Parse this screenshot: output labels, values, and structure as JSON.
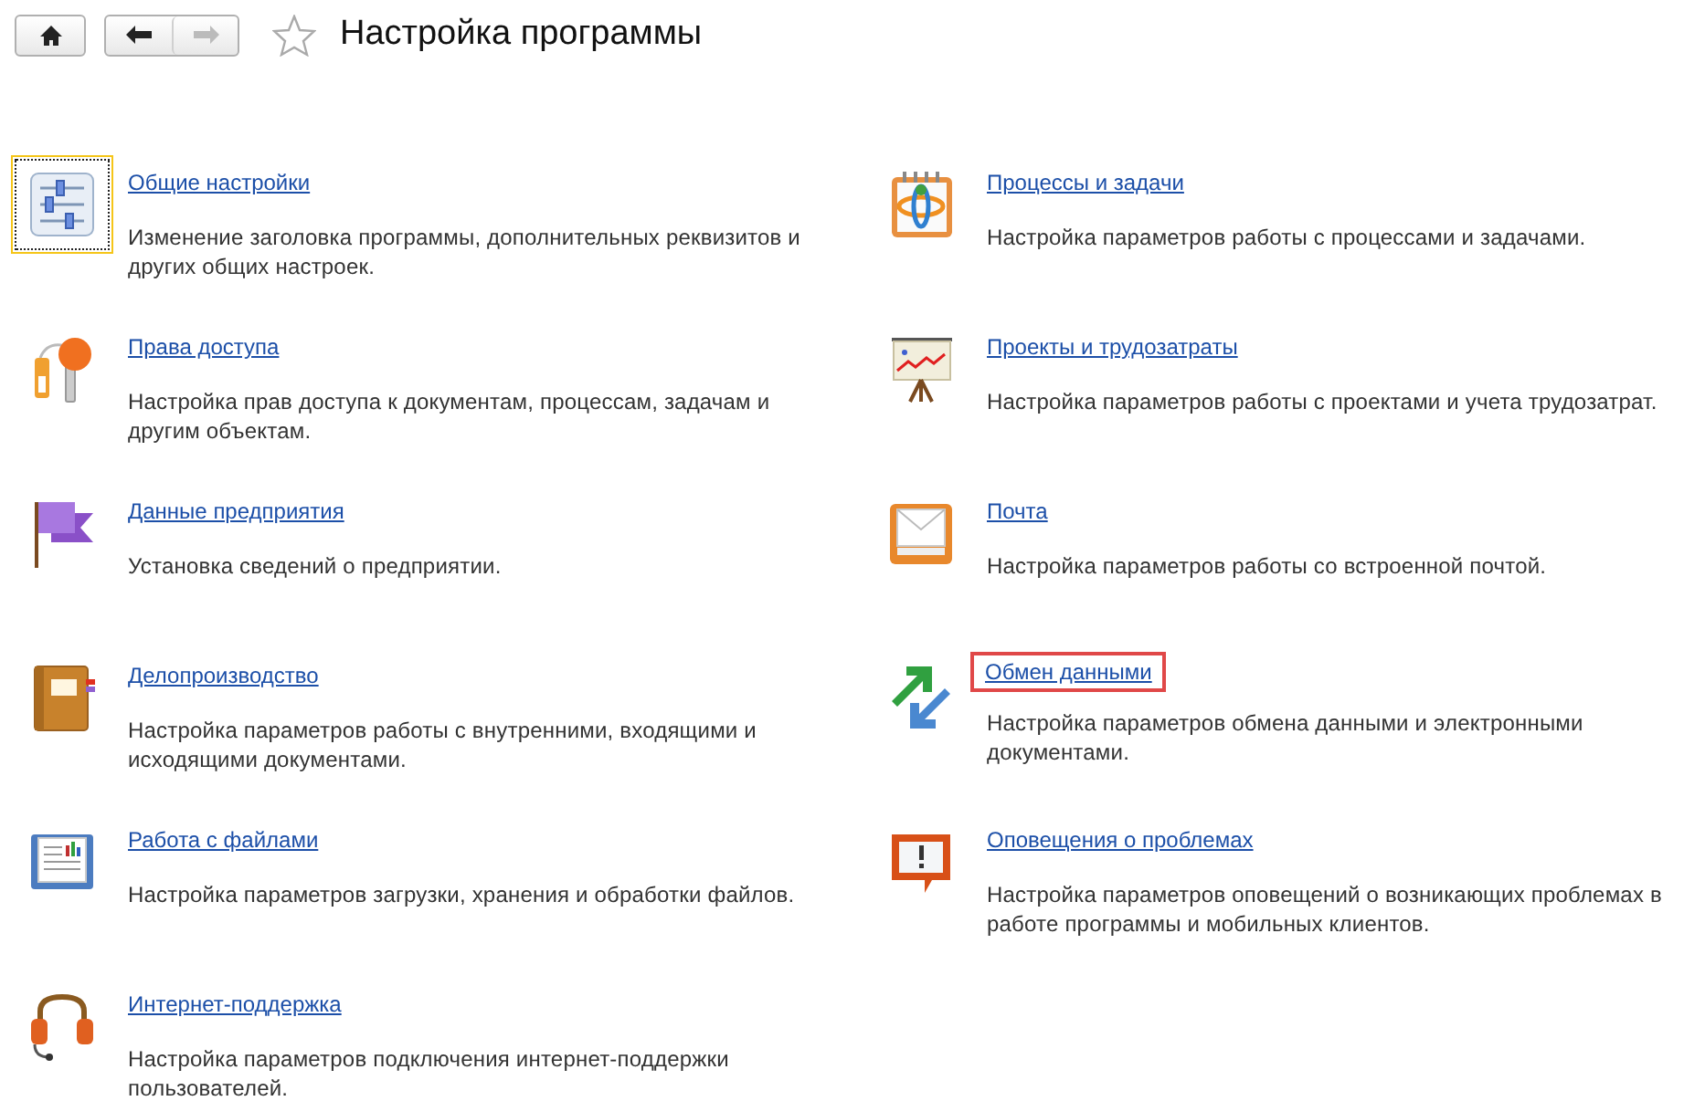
{
  "header": {
    "back": {
      "disabled": false
    },
    "forward": {
      "disabled": true
    },
    "favorite": {
      "on": false
    },
    "title": "Настройка программы"
  },
  "left_column": [
    {
      "title": "Общие настройки",
      "description": "Изменение заголовка программы, дополнительных реквизитов и других общих настроек.",
      "focused": true,
      "highlighted": false
    },
    {
      "title": "Права доступа",
      "description": "Настройка прав доступа к документам, процессам, задачам и другим объектам.",
      "focused": false,
      "highlighted": false
    },
    {
      "title": "Данные предприятия",
      "description": "Установка сведений о предприятии.",
      "focused": false,
      "highlighted": false
    },
    {
      "title": "Делопроизводство",
      "description": "Настройка параметров работы с внутренними, входящими и исходящими документами.",
      "focused": false,
      "highlighted": false
    },
    {
      "title": "Работа с файлами",
      "description": "Настройка параметров загрузки, хранения и обработки файлов.",
      "focused": false,
      "highlighted": false
    },
    {
      "title": "Интернет-поддержка",
      "description": "Настройка параметров подключения интернет-поддержки пользователей.",
      "focused": false,
      "highlighted": false
    }
  ],
  "right_column": [
    {
      "title": "Процессы и задачи",
      "description": "Настройка параметров работы с процессами и задачами.",
      "focused": false,
      "highlighted": false
    },
    {
      "title": "Проекты и трудозатраты",
      "description": "Настройка параметров работы с проектами и учета трудозатрат.",
      "focused": false,
      "highlighted": false
    },
    {
      "title": "Почта",
      "description": "Настройка параметров работы со встроенной почтой.",
      "focused": false,
      "highlighted": false
    },
    {
      "title": "Обмен данными",
      "description": "Настройка параметров обмена данными и электронными документами.",
      "focused": false,
      "highlighted": true
    },
    {
      "title": "Оповещения о проблемах",
      "description": "Настройка параметров оповещений о возникающих проблемах в работе программы и мобильных клиентов.",
      "focused": false,
      "highlighted": false
    }
  ]
}
